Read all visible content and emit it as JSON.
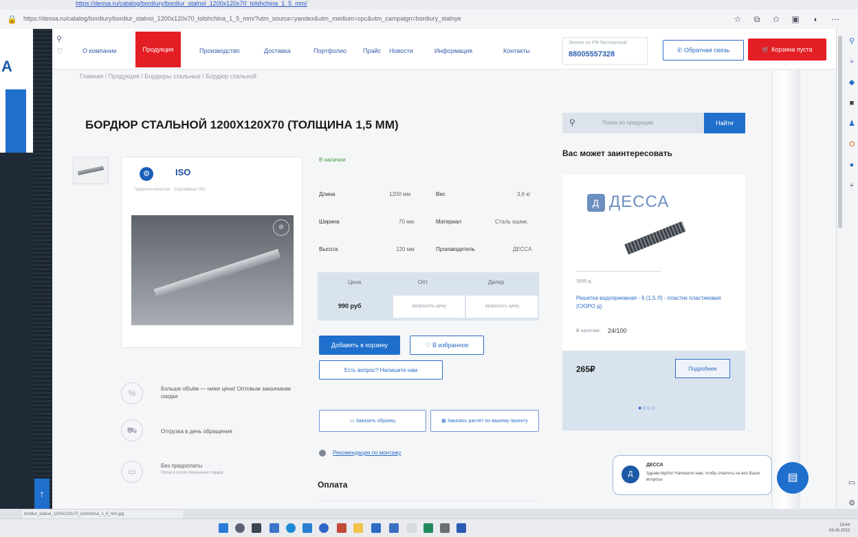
{
  "browser": {
    "top_link": "https://dessa.ru/catalog/bordiury/bordiur_stalnoi_1200x120x70_tolshchina_1_5_mm/",
    "url": "https://dessa.ru/catalog/bordiury/bordiur_stalnoi_1200x120x70_tolshchina_1_5_mm/?utm_source=yandex&utm_medium=cpc&utm_campaign=bordiury_stalnye",
    "status_bar": "bordiur_stalnoi_1200x120x70_tolshchina_1_5_mm.jpg"
  },
  "sidebar": {
    "brand_letter": "A"
  },
  "header": {
    "nav": [
      "О компании",
      "Продукция",
      "Производство",
      "Доставка",
      "Портфолио",
      "Прайс",
      "Новости",
      "Информация",
      "Контакты"
    ],
    "phone_label": "Звонок по РФ бесплатный",
    "phone": "88005557328",
    "callback_label": "Обратная связь",
    "cart_label": "Корзина пуста"
  },
  "breadcrumbs": "Главная / Продукция / Бордюры стальные / Бордюр стальной",
  "product": {
    "title": "БОРДЮР СТАЛЬНОЙ 1200X120X70 (ТОЛЩИНА 1,5 ММ)",
    "badge1_label": "Гарантия качества",
    "badge2": "ISO",
    "badge2_label": "Сертификат ISO",
    "in_stock": "В наличии",
    "specs": [
      {
        "name": "Длина",
        "value": "1200 мм"
      },
      {
        "name": "Ширина",
        "value": "70 мм"
      },
      {
        "name": "Высота",
        "value": "120 мм"
      }
    ],
    "specs2": [
      {
        "name": "Вес",
        "value": "3,6 кг"
      },
      {
        "name": "Материал",
        "value": "Сталь оцинк."
      },
      {
        "name": "Производитель",
        "value": "ДЕССА"
      }
    ],
    "price_headers": [
      "Цена",
      "Опт",
      "Дилер"
    ],
    "price": "990 руб",
    "price_cells": [
      "запросить цену",
      "запросить цену"
    ],
    "add_to_cart": "Добавить в корзину",
    "favorite": "В избранное",
    "ask": "Есть вопрос? Напишите нам",
    "features": [
      {
        "text": "Больше объём — ниже цена! Оптовым заказчикам скидки",
        "sub": ""
      },
      {
        "text": "Отгрузка в день обращения",
        "sub": ""
      },
      {
        "text": "Без предоплаты",
        "sub": "Оплата после получения товара"
      }
    ],
    "order_sample": "Заказать образец",
    "order_calc": "Заказать расчёт по вашему проекту",
    "recommend": "Рекомендации по монтажу",
    "payment_heading": "Оплата"
  },
  "right": {
    "search_placeholder": "Поиск по продукции",
    "search_button": "Найти",
    "interest_title": "Вас может заинтересовать",
    "card": {
      "logo": "ДЕССА",
      "code": "1695 д",
      "name": "Решетка водоприемная - 6 (1,5 Л) - пластик пластиковая (СЮРО д)",
      "stock_label": "В наличии:",
      "stock_value": "24/100",
      "price": "265₽",
      "more": "Подробнее",
      "dots": "●○○○"
    }
  },
  "chat": {
    "name": "ДЕССА",
    "text": "Здравствуйте! Напишите нам, чтобы ответить на все Ваши вопросы"
  },
  "taskbar": {
    "time": "19:44",
    "date": "06.06.2023"
  },
  "colors": {
    "accent_red": "#e31e24",
    "accent_blue": "#1f6fcc",
    "price_bg": "#d9e3ee"
  }
}
